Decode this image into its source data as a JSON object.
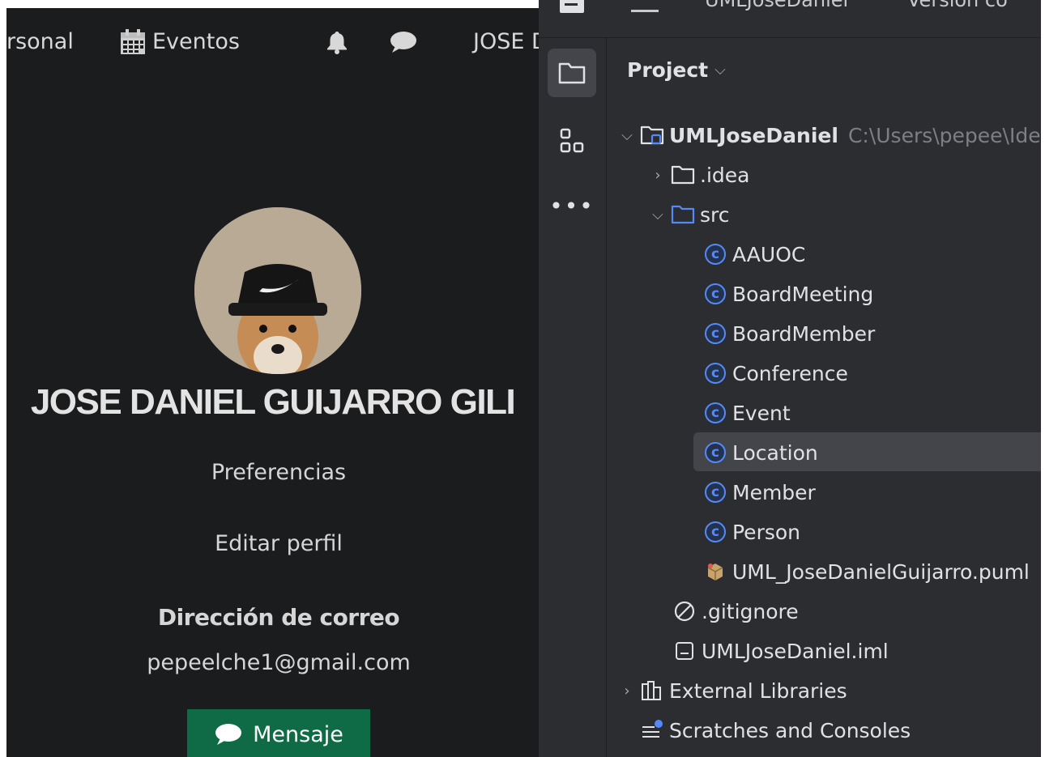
{
  "profile_page": {
    "nav": {
      "personal": "rsonal",
      "eventos": "Eventos",
      "user": "JOSE D"
    },
    "icons": {
      "calendar": "calendar-icon",
      "bell": "bell-icon",
      "chat": "chat-icon"
    },
    "name": "JOSE DANIEL GUIJARRO GILI",
    "preferences_link": "Preferencias",
    "edit_profile_link": "Editar perfil",
    "email_label": "Dirección de correo",
    "email_value": "pepeelche1@gmail.com",
    "message_button": "Mensaje",
    "colors": {
      "background": "#1b1c1e",
      "button": "#0f6b45"
    }
  },
  "ide": {
    "titlebar": {
      "project_name": "UMLJoseDaniel",
      "vcs": "Version co"
    },
    "panel_title": "Project",
    "tree": {
      "root": {
        "label": "UMLJoseDaniel",
        "path": "C:\\Users\\pepee\\Ide"
      },
      "idea": ".idea",
      "src": "src",
      "classes": [
        "AAUOC",
        "BoardMeeting",
        "BoardMember",
        "Conference",
        "Event",
        "Location",
        "Member",
        "Person"
      ],
      "selected_class": "Location",
      "puml_file": "UML_JoseDanielGuijarro.puml",
      "gitignore": ".gitignore",
      "iml_file": "UMLJoseDaniel.iml",
      "external_libraries": "External Libraries",
      "scratches": "Scratches and Consoles"
    },
    "colors": {
      "background": "#2b2d30",
      "selection": "#43454a",
      "class_icon": "#548af7"
    }
  }
}
